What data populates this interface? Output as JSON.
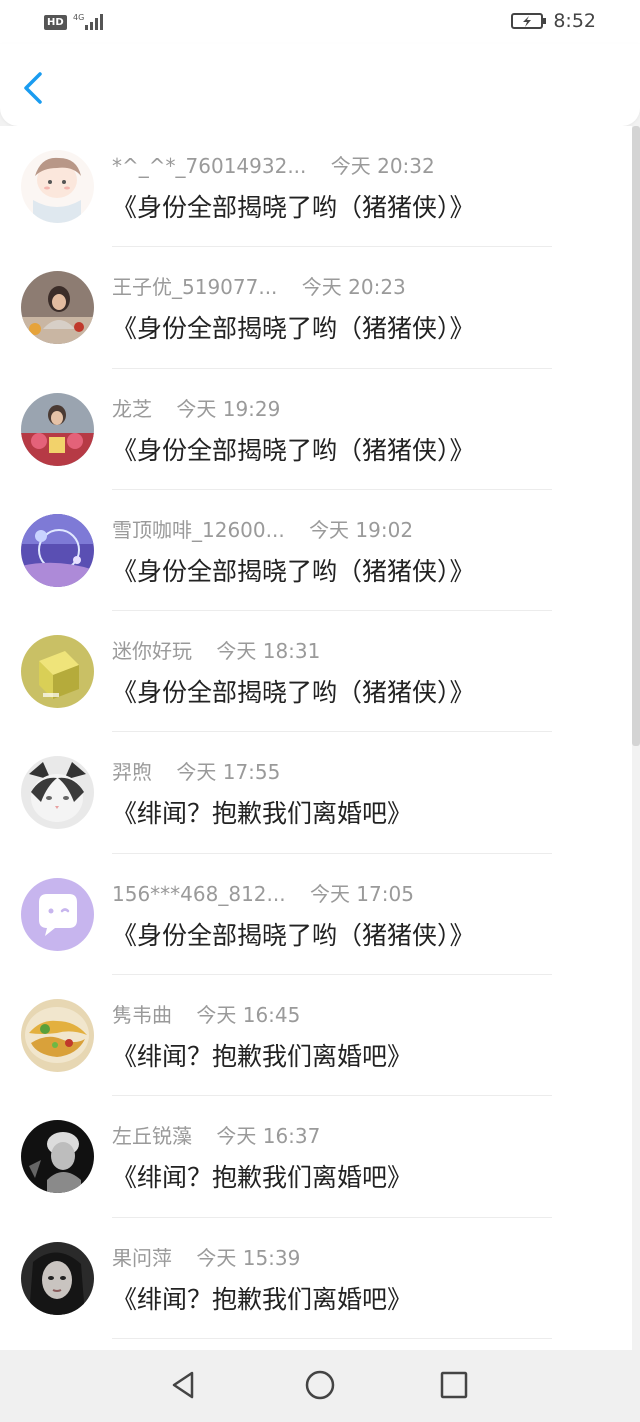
{
  "status_bar": {
    "network_badge": "HD",
    "network_type": "4G",
    "time": "8:52",
    "icons": [
      "signal-icon",
      "battery-charging-icon"
    ]
  },
  "header": {
    "back_icon": "chevron-left-icon",
    "accent_color": "#1a9cf0"
  },
  "list": [
    {
      "name": "*^_^*_76014932...",
      "time": "今天 20:32",
      "title": "《身份全部揭晓了哟（猪猪侠）》",
      "avatar": "avatar-cartoon-boy"
    },
    {
      "name": "王子优_519077...",
      "time": "今天 20:23",
      "title": "《身份全部揭晓了哟（猪猪侠）》",
      "avatar": "avatar-photo"
    },
    {
      "name": "龙芝",
      "time": "今天 19:29",
      "title": "《身份全部揭晓了哟（猪猪侠）》",
      "avatar": "avatar-photo-flowers"
    },
    {
      "name": "雪顶咖啡_12600...",
      "time": "今天 19:02",
      "title": "《身份全部揭晓了哟（猪猪侠）》",
      "avatar": "avatar-bubbles"
    },
    {
      "name": "迷你好玩",
      "time": "今天 18:31",
      "title": "《身份全部揭晓了哟（猪猪侠）》",
      "avatar": "avatar-yellow-block"
    },
    {
      "name": "羿煦",
      "time": "今天 17:55",
      "title": "《绯闻？抱歉我们离婚吧》",
      "avatar": "avatar-cat"
    },
    {
      "name": "156***468_812...",
      "time": "今天 17:05",
      "title": "《身份全部揭晓了哟（猪猪侠）》",
      "avatar": "avatar-default-chat"
    },
    {
      "name": "隽韦曲",
      "time": "今天 16:45",
      "title": "《绯闻？抱歉我们离婚吧》",
      "avatar": "avatar-food"
    },
    {
      "name": "左丘锐藻",
      "time": "今天 16:37",
      "title": "《绯闻？抱歉我们离婚吧》",
      "avatar": "avatar-portrait-dark"
    },
    {
      "name": "果问萍",
      "time": "今天 15:39",
      "title": "《绯闻？抱歉我们离婚吧》",
      "avatar": "avatar-portrait-girl"
    }
  ],
  "nav_bar": {
    "icons": [
      "nav-back-icon",
      "nav-home-icon",
      "nav-recent-icon"
    ]
  }
}
